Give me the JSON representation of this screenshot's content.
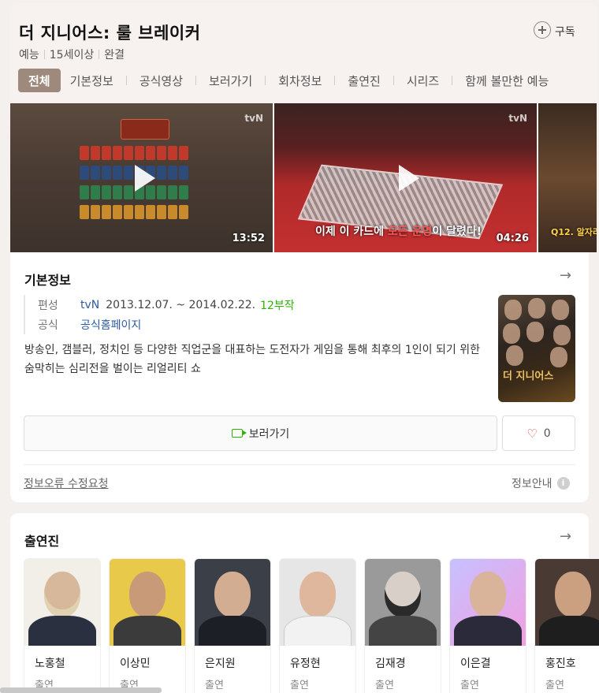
{
  "header": {
    "title": "더 지니어스: 룰 브레이커",
    "meta": [
      "예능",
      "15세이상",
      "완결"
    ],
    "subscribe_label": "구독"
  },
  "tabs": [
    "전체",
    "기본정보",
    "공식영상",
    "보러가기",
    "회차정보",
    "출연진",
    "시리즈",
    "함께 볼만한 예능"
  ],
  "videos": [
    {
      "duration": "13:52",
      "tag": "tvN",
      "caption": ""
    },
    {
      "duration": "04:26",
      "tag": "tvN",
      "caption_pre": "이제 이 카드에 ",
      "caption_hl": "모든 운명",
      "caption_post": "이 달렸다!"
    },
    {
      "duration": "",
      "tag": "tvN",
      "caption": "Q12. 알자리"
    }
  ],
  "basic_info": {
    "section_title": "기본정보",
    "rows": {
      "broadcast_label": "편성",
      "channel": "tvN",
      "period": "2013.12.07. ~ 2014.02.22.",
      "episodes": "12부작",
      "official_label": "공식",
      "official_link": "공식홈페이지"
    },
    "description": "방송인, 갬블러, 정치인 등 다양한 직업군을 대표하는 도전자가 게임을 통해 최후의 1인이 되기 위한 숨막히는 심리전을 벌이는 리얼리티 쇼",
    "poster_title": "더 지니어스",
    "watch_label": "보러가기",
    "like_count": "0",
    "report_label": "정보오류 수정요청",
    "notice_label": "정보안내"
  },
  "cast": {
    "section_title": "출연진",
    "members": [
      {
        "name": "노홍철",
        "role": "출연"
      },
      {
        "name": "이상민",
        "role": "출연"
      },
      {
        "name": "은지원",
        "role": "출연"
      },
      {
        "name": "유정현",
        "role": "출연"
      },
      {
        "name": "김재경",
        "role": "출연"
      },
      {
        "name": "이은결",
        "role": "출연"
      },
      {
        "name": "홍진호",
        "role": "출연"
      }
    ]
  },
  "colors": {
    "active_tab": "#9e8a7c",
    "link": "#2b5aa8",
    "green": "#2db400",
    "heart": "#e23c3c"
  }
}
